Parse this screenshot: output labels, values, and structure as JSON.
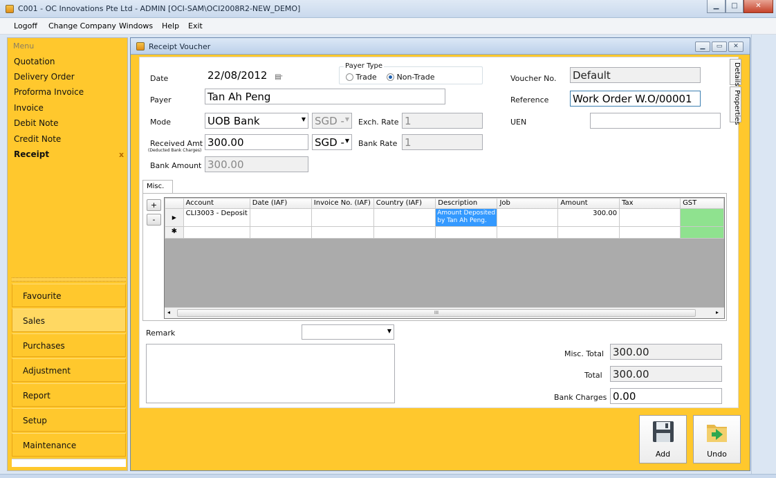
{
  "window": {
    "title": "C001 - OC Innovations Pte Ltd - ADMIN [OCI-SAM\\OCI2008R2-NEW_DEMO]"
  },
  "menubar": [
    "Logoff",
    "Change Company",
    "Windows",
    "Help",
    "Exit"
  ],
  "sidebar": {
    "header": "Menu",
    "items": [
      "Quotation",
      "Delivery Order",
      "Proforma Invoice",
      "Invoice",
      "Debit Note",
      "Credit Note",
      "Receipt"
    ],
    "selected_close": "x",
    "nav": [
      "Favourite",
      "Sales",
      "Purchases",
      "Adjustment",
      "Report",
      "Setup",
      "Maintenance"
    ]
  },
  "child": {
    "title": "Receipt Voucher"
  },
  "form": {
    "date_label": "Date",
    "date_value": "22/08/2012",
    "payer_type_label": "Payer Type",
    "payer_type_options": [
      "Trade",
      "Non-Trade"
    ],
    "payer_type_selected": "Non-Trade",
    "voucher_label": "Voucher No.",
    "voucher_value": "Default",
    "payer_label": "Payer",
    "payer_value": "Tan Ah Peng",
    "reference_label": "Reference",
    "reference_value": "Work Order W.O/00001",
    "mode_label": "Mode",
    "mode_value": "UOB Bank",
    "mode_currency": "SGD -",
    "exch_label": "Exch. Rate",
    "exch_value": "1",
    "uen_label": "UEN",
    "uen_value": "",
    "received_label": "Received Amt",
    "received_sublabel": "(Deducted Bank Charges)",
    "received_value": "300.00",
    "received_currency": "SGD -",
    "bank_rate_label": "Bank Rate",
    "bank_rate_value": "1",
    "bank_amount_label": "Bank Amount",
    "bank_amount_value": "300.00"
  },
  "tab": {
    "label": "Misc."
  },
  "grid": {
    "add": "+",
    "remove": "-",
    "columns": [
      "Account",
      "Date (IAF)",
      "Invoice No. (IAF)",
      "Country (IAF)",
      "Description",
      "Job",
      "Amount",
      "Tax",
      "GST"
    ],
    "rows": [
      {
        "marker": "▶",
        "cells": [
          "CLI3003 - Deposit",
          "",
          "",
          "",
          "Amount Deposited by Tan Ah Peng.",
          "",
          "300.00",
          "",
          ""
        ]
      },
      {
        "marker": "✱",
        "cells": [
          "",
          "",
          "",
          "",
          "",
          "",
          "",
          "",
          ""
        ]
      }
    ],
    "scroll_grip": "III"
  },
  "remark": {
    "label": "Remark",
    "value": ""
  },
  "totals": {
    "misc_label": "Misc. Total",
    "misc_value": "300.00",
    "total_label": "Total",
    "total_value": "300.00",
    "charges_label": "Bank Charges",
    "charges_value": "0.00"
  },
  "side_tabs": [
    "Details",
    "Properties"
  ],
  "actions": {
    "add": "Add",
    "undo": "Undo"
  }
}
